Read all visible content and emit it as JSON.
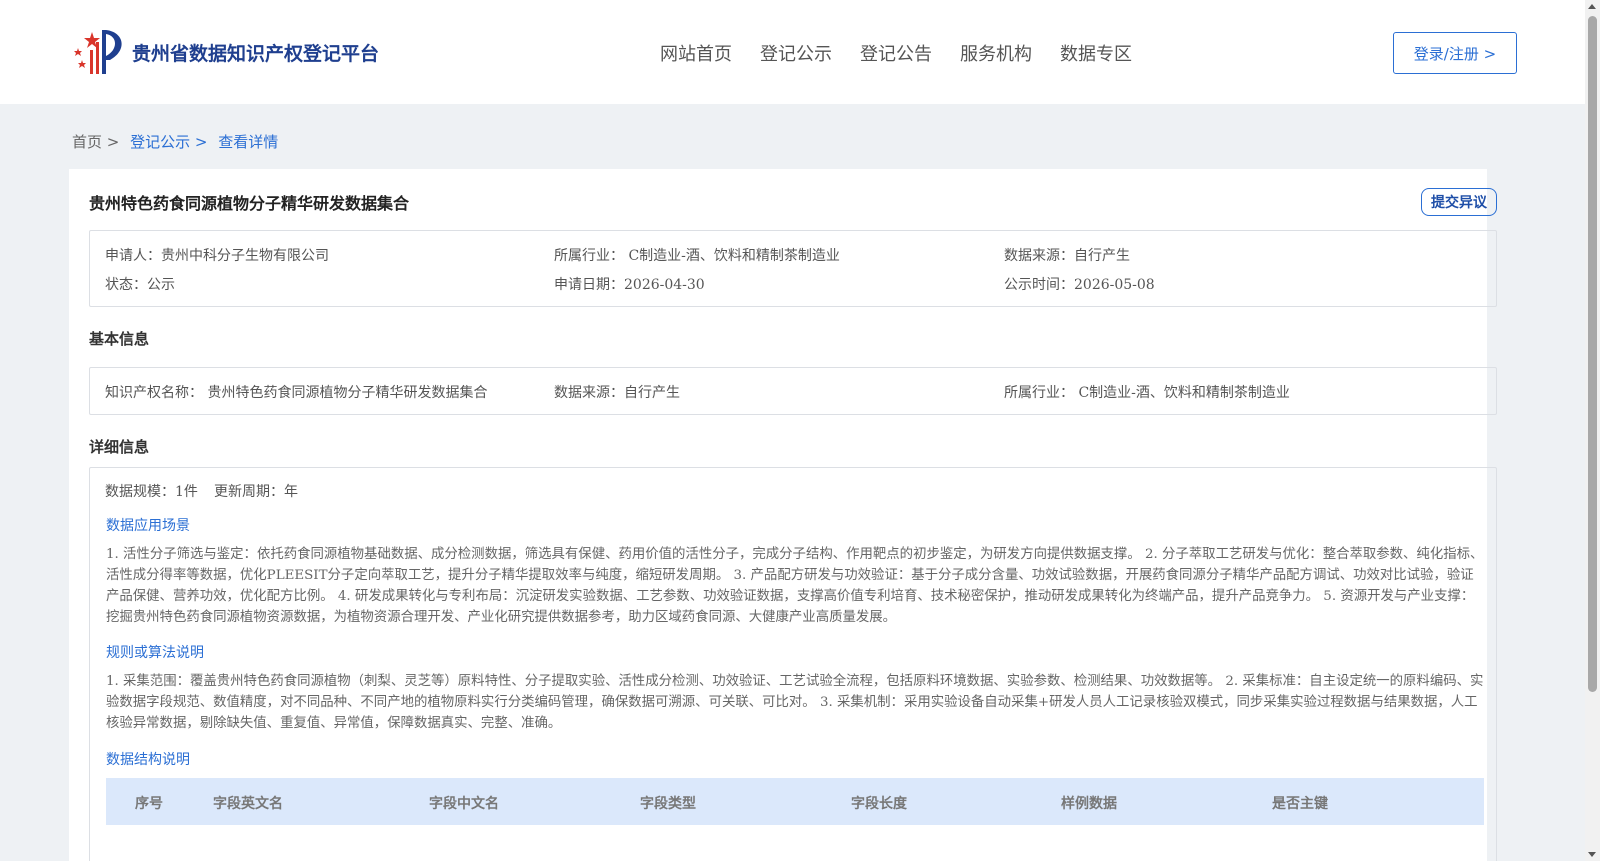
{
  "header": {
    "logo_text": "贵州省数据知识产权登记平台",
    "nav": [
      "网站首页",
      "登记公示",
      "登记公告",
      "服务机构",
      "数据专区"
    ],
    "login_label": "登录/注册 >"
  },
  "breadcrumb": {
    "home": "首页 >",
    "level2": "登记公示 >",
    "level3": "查看详情"
  },
  "record": {
    "title": "贵州特色药食同源植物分子精华研发数据集合",
    "objection_label": "提交异议",
    "applicant": "申请人：贵州中科分子生物有限公司",
    "industry": "所属行业： C制造业-酒、饮料和精制茶制造业",
    "data_source": "数据来源：自行产生",
    "status": "状态：公示",
    "apply_date": "申请日期：2026-04-30",
    "publish_date": "公示时间：2026-05-08"
  },
  "basic": {
    "heading": "基本信息",
    "ip_name": "知识产权名称： 贵州特色药食同源植物分子精华研发数据集合",
    "data_source": "数据来源：自行产生",
    "industry": "所属行业： C制造业-酒、饮料和精制茶制造业"
  },
  "detail": {
    "heading": "详细信息",
    "scale": "数据规模：1件",
    "cycle": "更新周期：年",
    "scenario_heading": "数据应用场景",
    "scenario_text": "1. 活性分子筛选与鉴定：依托药食同源植物基础数据、成分检测数据，筛选具有保健、药用价值的活性分子，完成分子结构、作用靶点的初步鉴定，为研发方向提供数据支撑。 2. 分子萃取工艺研发与优化：整合萃取参数、纯化指标、活性成分得率等数据，优化PLEESIT分子定向萃取工艺，提升分子精华提取效率与纯度，缩短研发周期。 3. 产品配方研发与功效验证：基于分子成分含量、功效试验数据，开展药食同源分子精华产品配方调试、功效对比试验，验证产品保健、营养功效，优化配方比例。 4. 研发成果转化与专利布局：沉淀研发实验数据、工艺参数、功效验证数据，支撑高价值专利培育、技术秘密保护，推动研发成果转化为终端产品，提升产品竞争力。 5. 资源开发与产业支撑：挖掘贵州特色药食同源植物资源数据，为植物资源合理开发、产业化研究提供数据参考，助力区域药食同源、大健康产业高质量发展。",
    "rules_heading": "规则或算法说明",
    "rules_text": "1. 采集范围：覆盖贵州特色药食同源植物（刺梨、灵芝等）原料特性、分子提取实验、活性成分检测、功效验证、工艺试验全流程，包括原料环境数据、实验参数、检测结果、功效数据等。 2. 采集标准：自主设定统一的原料编码、实验数据字段规范、数值精度，对不同品种、不同产地的植物原料实行分类编码管理，确保数据可溯源、可关联、可比对。 3. 采集机制：采用实验设备自动采集+研发人员人工记录核验双模式，同步采集实验过程数据与结果数据，人工核验异常数据，剔除缺失值、重复值、异常值，保障数据真实、完整、准确。",
    "structure_heading": "数据结构说明",
    "table_headers": [
      "序号",
      "字段英文名",
      "字段中文名",
      "字段类型",
      "字段长度",
      "样例数据",
      "是否主键"
    ]
  }
}
